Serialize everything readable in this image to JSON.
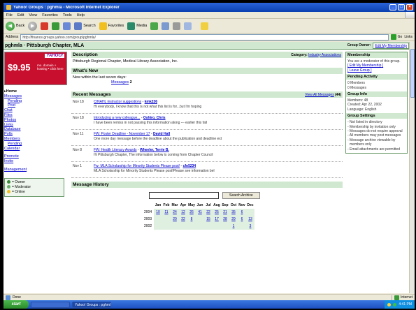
{
  "browser": {
    "title": "Yahoo! Groups : pghmla - Microsoft Internet Explorer",
    "menu": [
      "File",
      "Edit",
      "View",
      "Favorites",
      "Tools",
      "Help"
    ],
    "toolbar": {
      "back": "Back",
      "search": "Search",
      "favorites": "Favorites",
      "media": "Media"
    },
    "address_label": "Address",
    "address_value": "http://finance.groups.yahoo.com/group/pghmla/",
    "go_label": "Go",
    "links_label": "Links",
    "status_text": "Done",
    "zone_text": "Internet"
  },
  "taskbar": {
    "start": "start",
    "items": [
      "",
      "Yahoo! Groups : pghmla"
    ],
    "clock": "4:41 PM"
  },
  "group": {
    "name": "pghmla · Pittsburgh Chapter, MLA",
    "owner_label": "Group Owner:",
    "edit_button": "Edit My Membership"
  },
  "ad": {
    "brand": "YAHOO!",
    "price": "$9.95",
    "offer": "mo. domain + hosting • click here"
  },
  "nav": {
    "home": "Home",
    "messages": "Messages",
    "pending1": "Pending",
    "post": "Post",
    "chat": "Chat",
    "files": "Files",
    "photos": "Photos",
    "links": "Links",
    "database": "Database",
    "polls": "Polls",
    "members": "Members",
    "pending2": "Pending",
    "calendar": "Calendar",
    "promote": "Promote",
    "invite": "Invite",
    "management": "Management"
  },
  "legend": [
    "= Owner",
    "= Moderator",
    "= Online"
  ],
  "description": {
    "title": "Description",
    "category_label": "Category:",
    "category_value": "Industry Associations",
    "text": "Pittsburgh Regional Chapter, Medical Library Association, Inc."
  },
  "whats_new": {
    "title": "What's New",
    "text": "New within the last seven days:",
    "messages_link": "Messages",
    "messages_count": "2"
  },
  "recent": {
    "title": "Recent Messages",
    "view_all": "View All Messages",
    "count": "(44)",
    "items": [
      {
        "date": "Nov 18",
        "subject": "CINAHL instructor suggestions",
        "author": "kmk236",
        "preview": "Hi everybody, I know that this is not what this list is for...but I'm hoping"
      },
      {
        "date": "Nov 18",
        "subject": "Introducing a new colleague...",
        "author": "Oshiro, Chris",
        "preview": "I have been remiss in not passing this information along --- earlier this fall"
      },
      {
        "date": "Nov 11",
        "subject": "FW: Poster Deadline - November 17",
        "author": "David Hall",
        "preview": "One more day message before the deadline about the publication and deadline ext"
      },
      {
        "date": "Nov 8",
        "subject": "FW: Health Literacy Awards",
        "author": "Wheeler, Terrie B.",
        "preview": "Hi Pittsburgh Chapter, The information below is coming from Chapter Council"
      },
      {
        "date": "Nov 1",
        "subject": "Fw: MLA Scholarship for Minority Students Please post!",
        "author": "cfn5234",
        "preview": "MLA Scholarship for Minority Students Please post!Please see information bel"
      }
    ]
  },
  "history": {
    "title": "Message History",
    "search_button": "Search Archive",
    "months": [
      "Jan",
      "Feb",
      "Mar",
      "Apr",
      "May",
      "Jun",
      "Jul",
      "Aug",
      "Sep",
      "Oct",
      "Nov",
      "Dec"
    ],
    "rows": [
      {
        "year": "2004",
        "cells": [
          "10",
          "11",
          "24",
          "12",
          "26",
          "41",
          "22",
          "25",
          "21",
          "35",
          "6",
          ""
        ]
      },
      {
        "year": "2003",
        "cells": [
          "",
          "",
          "20",
          "22",
          "8",
          "",
          "15",
          "17",
          "28",
          "29",
          "6",
          "13"
        ]
      },
      {
        "year": "2002",
        "cells": [
          "",
          "",
          "",
          "",
          "",
          "",
          "",
          "",
          "",
          "1",
          "",
          "3"
        ]
      }
    ]
  },
  "membership": {
    "title": "Membership",
    "text": "You are a moderator of this group.",
    "edit_link": "Edit My Membership",
    "leave_link": "Leave Group"
  },
  "pending": {
    "title": "Pending Activity",
    "lines": [
      "0 Members",
      "0 Messages"
    ]
  },
  "info": {
    "title": "Group Info",
    "members": "Members: 48",
    "founded": "Created: Apr 22, 2002",
    "language": "Language: English"
  },
  "settings": {
    "title": "Group Settings",
    "items": [
      "- Not listed in directory",
      "- Membership by invitation only",
      "- Messages do not require approval",
      "- All members may post messages",
      "- Message archive viewable by members only",
      "- Email attachments are permitted"
    ]
  }
}
